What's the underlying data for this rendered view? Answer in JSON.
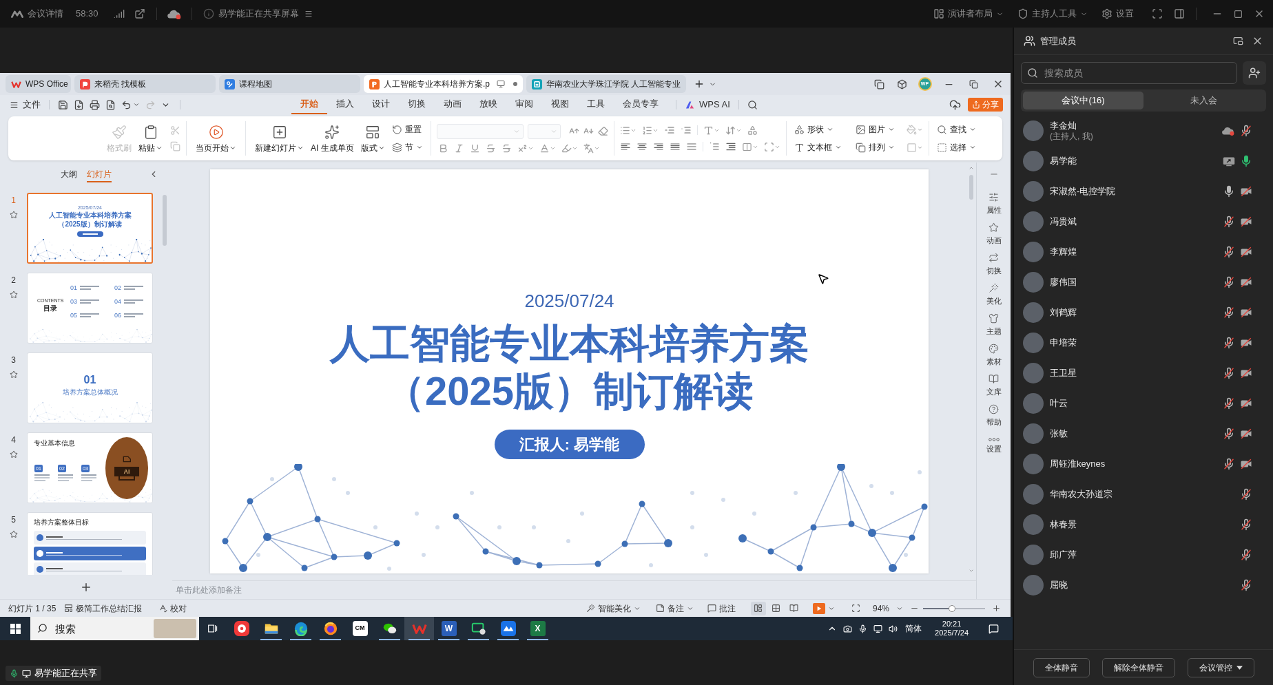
{
  "meeting_bar": {
    "details": "会议详情",
    "timer": "58:30",
    "sharing_notice": "易学能正在共享屏幕",
    "layout": "演讲者布局",
    "host_tools": "主持人工具",
    "settings": "设置"
  },
  "wps": {
    "tabs": [
      {
        "kind": "home",
        "label": "WPS Office",
        "selected": false
      },
      {
        "kind": "docer",
        "label": "来稻壳 找模板",
        "selected": false
      },
      {
        "kind": "map",
        "label": "课程地图",
        "selected": false
      },
      {
        "kind": "presentation",
        "label": "人工智能专业本科培养方案.p",
        "selected": true
      },
      {
        "kind": "web",
        "label": "华南农业大学珠江学院 人工智能专业",
        "selected": false
      }
    ],
    "account_initials": "WP",
    "file_menu": "文件",
    "ribbon_tabs": [
      {
        "label": "开始",
        "selected": true
      },
      {
        "label": "插入",
        "selected": false
      },
      {
        "label": "设计",
        "selected": false
      },
      {
        "label": "切换",
        "selected": false
      },
      {
        "label": "动画",
        "selected": false
      },
      {
        "label": "放映",
        "selected": false
      },
      {
        "label": "审阅",
        "selected": false
      },
      {
        "label": "视图",
        "selected": false
      },
      {
        "label": "工具",
        "selected": false
      },
      {
        "label": "会员专享",
        "selected": false
      }
    ],
    "ai_button": "WPS AI",
    "share_button": "分享",
    "ribbon": {
      "clipboard": [
        {
          "kind": "format-painter",
          "label": "格式刷",
          "disabled": true,
          "dropdown": false
        },
        {
          "kind": "paste",
          "label": "粘贴",
          "disabled": false,
          "dropdown": true
        }
      ],
      "slideshow": [
        {
          "kind": "play-current",
          "label": "当页开始",
          "disabled": false,
          "dropdown": true
        }
      ],
      "slides": [
        {
          "kind": "new-slide",
          "label": "新建幻灯片",
          "disabled": false,
          "dropdown": true
        },
        {
          "kind": "ai-page",
          "label": "AI 生成单页",
          "disabled": false,
          "dropdown": false
        },
        {
          "kind": "layout",
          "label": "版式",
          "disabled": false,
          "dropdown": true
        }
      ],
      "slide_tools": [
        {
          "kind": "reset",
          "label": "重置",
          "disabled": false,
          "dropdown": false
        },
        {
          "kind": "section",
          "label": "节",
          "disabled": false,
          "dropdown": true
        }
      ],
      "insert": [
        {
          "kind": "shape",
          "label": "形状",
          "disabled": false,
          "dropdown": true
        },
        {
          "kind": "picture",
          "label": "图片",
          "disabled": false,
          "dropdown": true
        },
        {
          "kind": "textbox",
          "label": "文本框",
          "disabled": false,
          "dropdown": true
        },
        {
          "kind": "arrange",
          "label": "排列",
          "disabled": false,
          "dropdown": true
        }
      ],
      "find": [
        {
          "kind": "find",
          "label": "查找",
          "disabled": false,
          "dropdown": true
        },
        {
          "kind": "select",
          "label": "选择",
          "disabled": false,
          "dropdown": true
        }
      ]
    },
    "side_panel": {
      "tabs": [
        {
          "label": "大纲",
          "selected": false
        },
        {
          "label": "幻灯片",
          "selected": true
        }
      ],
      "slides": [
        {
          "kind": "title",
          "number": "1",
          "selected": true,
          "date": "2025/07/24",
          "title_lines": [
            "人工智能专业本科培养方案",
            "（2025版）制订解读"
          ]
        },
        {
          "kind": "contents",
          "number": "2",
          "selected": false,
          "label": "CONTENTS",
          "title": "目录",
          "items": [
            "01",
            "02",
            "03",
            "04",
            "05",
            "06"
          ]
        },
        {
          "kind": "section",
          "number": "3",
          "selected": false,
          "section_number": "01",
          "title": "培养方案总体概况"
        },
        {
          "kind": "info",
          "number": "4",
          "selected": false,
          "title": "专业基本信息",
          "badges": [
            "01",
            "02",
            "03"
          ],
          "image_text": "AI"
        },
        {
          "kind": "goals",
          "number": "5",
          "selected": false,
          "title": "培养方案整体目标",
          "rows": [
            {
              "highlighted": false
            },
            {
              "highlighted": true
            },
            {
              "highlighted": false
            }
          ]
        }
      ]
    },
    "slide": {
      "date": "2025/07/24",
      "title_lines": [
        "人工智能专业本科培养方案",
        "（2025版）制订解读"
      ],
      "presenter": "汇报人: 易学能"
    },
    "notes_placeholder": "单击此处添加备注",
    "side_tools": [
      {
        "kind": "properties",
        "label": "属性"
      },
      {
        "kind": "animation",
        "label": "动画"
      },
      {
        "kind": "transition",
        "label": "切换"
      },
      {
        "kind": "beautify",
        "label": "美化"
      },
      {
        "kind": "theme",
        "label": "主题"
      },
      {
        "kind": "assets",
        "label": "素材"
      },
      {
        "kind": "library",
        "label": "文库"
      },
      {
        "kind": "help",
        "label": "帮助"
      },
      {
        "kind": "settings",
        "label": "设置"
      }
    ],
    "status_bar": {
      "slide_counter": "幻灯片 1 / 35",
      "template": "极简工作总结汇报",
      "proofread": "校对",
      "smart_beautify": "智能美化",
      "notes": "备注",
      "comments": "批注",
      "views": [
        {
          "kind": "normal",
          "selected": true
        },
        {
          "kind": "sorter",
          "selected": false
        },
        {
          "kind": "reading",
          "selected": false
        }
      ],
      "zoom": "94%",
      "zoom_slider": {
        "level": 0.47
      }
    }
  },
  "taskbar": {
    "search_placeholder": "搜索",
    "apps": [
      {
        "kind": "vivaldi",
        "running": false,
        "selected": false
      },
      {
        "kind": "explorer",
        "running": true,
        "selected": false
      },
      {
        "kind": "edge",
        "running": true,
        "selected": false
      },
      {
        "kind": "firefox",
        "running": true,
        "selected": false
      },
      {
        "kind": "cm",
        "icon_text": "CM",
        "running": false,
        "selected": false
      },
      {
        "kind": "wechat",
        "running": true,
        "selected": false
      },
      {
        "kind": "wps",
        "running": true,
        "selected": true
      },
      {
        "kind": "word",
        "icon_text": "W",
        "running": true,
        "selected": false
      },
      {
        "kind": "remote",
        "running": true,
        "selected": false
      },
      {
        "kind": "meeting",
        "running": true,
        "selected": false
      },
      {
        "kind": "excel",
        "icon_text": "X",
        "running": true,
        "selected": false
      }
    ],
    "input_method": "简体",
    "time": "20:21",
    "date": "2025/7/24"
  },
  "sharing_badge": "易学能正在共享",
  "members_panel": {
    "title": "管理成员",
    "search_placeholder": "搜索成员",
    "tabs": [
      {
        "label": "会议中(16)",
        "selected": true
      },
      {
        "label": "未入会",
        "selected": false
      }
    ],
    "members": [
      {
        "name": "李金灿",
        "note": "(主持人, 我)",
        "icons": [
          {
            "kind": "cloud-recording"
          },
          {
            "kind": "mic-muted"
          }
        ]
      },
      {
        "name": "易学能",
        "icons": [
          {
            "kind": "screen-sharing"
          },
          {
            "kind": "mic-speaking"
          }
        ]
      },
      {
        "name": "宋淑然-电控学院",
        "icons": [
          {
            "kind": "mic-on"
          },
          {
            "kind": "camera-off"
          }
        ]
      },
      {
        "name": "冯贵斌",
        "icons": [
          {
            "kind": "mic-muted"
          },
          {
            "kind": "camera-off"
          }
        ]
      },
      {
        "name": "李辉煌",
        "icons": [
          {
            "kind": "mic-muted"
          },
          {
            "kind": "camera-off"
          }
        ]
      },
      {
        "name": "廖伟国",
        "icons": [
          {
            "kind": "mic-muted"
          },
          {
            "kind": "camera-off"
          }
        ]
      },
      {
        "name": "刘鹤辉",
        "icons": [
          {
            "kind": "mic-muted"
          },
          {
            "kind": "camera-off"
          }
        ]
      },
      {
        "name": "申培荣",
        "icons": [
          {
            "kind": "mic-muted"
          },
          {
            "kind": "camera-off"
          }
        ]
      },
      {
        "name": "王卫星",
        "icons": [
          {
            "kind": "mic-muted"
          },
          {
            "kind": "camera-off"
          }
        ]
      },
      {
        "name": "叶云",
        "icons": [
          {
            "kind": "mic-muted"
          },
          {
            "kind": "camera-off"
          }
        ]
      },
      {
        "name": "张敏",
        "icons": [
          {
            "kind": "mic-muted"
          },
          {
            "kind": "camera-off"
          }
        ]
      },
      {
        "name": "周钰淮keynes",
        "icons": [
          {
            "kind": "mic-muted"
          },
          {
            "kind": "camera-off"
          }
        ]
      },
      {
        "name": "华南农大孙道宗",
        "icons": [
          {
            "kind": "mic-muted"
          }
        ]
      },
      {
        "name": "林春景",
        "icons": [
          {
            "kind": "mic-muted"
          }
        ]
      },
      {
        "name": "邱广萍",
        "icons": [
          {
            "kind": "mic-muted"
          }
        ]
      },
      {
        "name": "屈晓",
        "icons": [
          {
            "kind": "mic-muted"
          }
        ]
      }
    ],
    "actions": [
      {
        "label": "全体静音",
        "dropdown": false
      },
      {
        "label": "解除全体静音",
        "dropdown": false
      },
      {
        "label": "会议管控",
        "dropdown": true
      }
    ]
  }
}
